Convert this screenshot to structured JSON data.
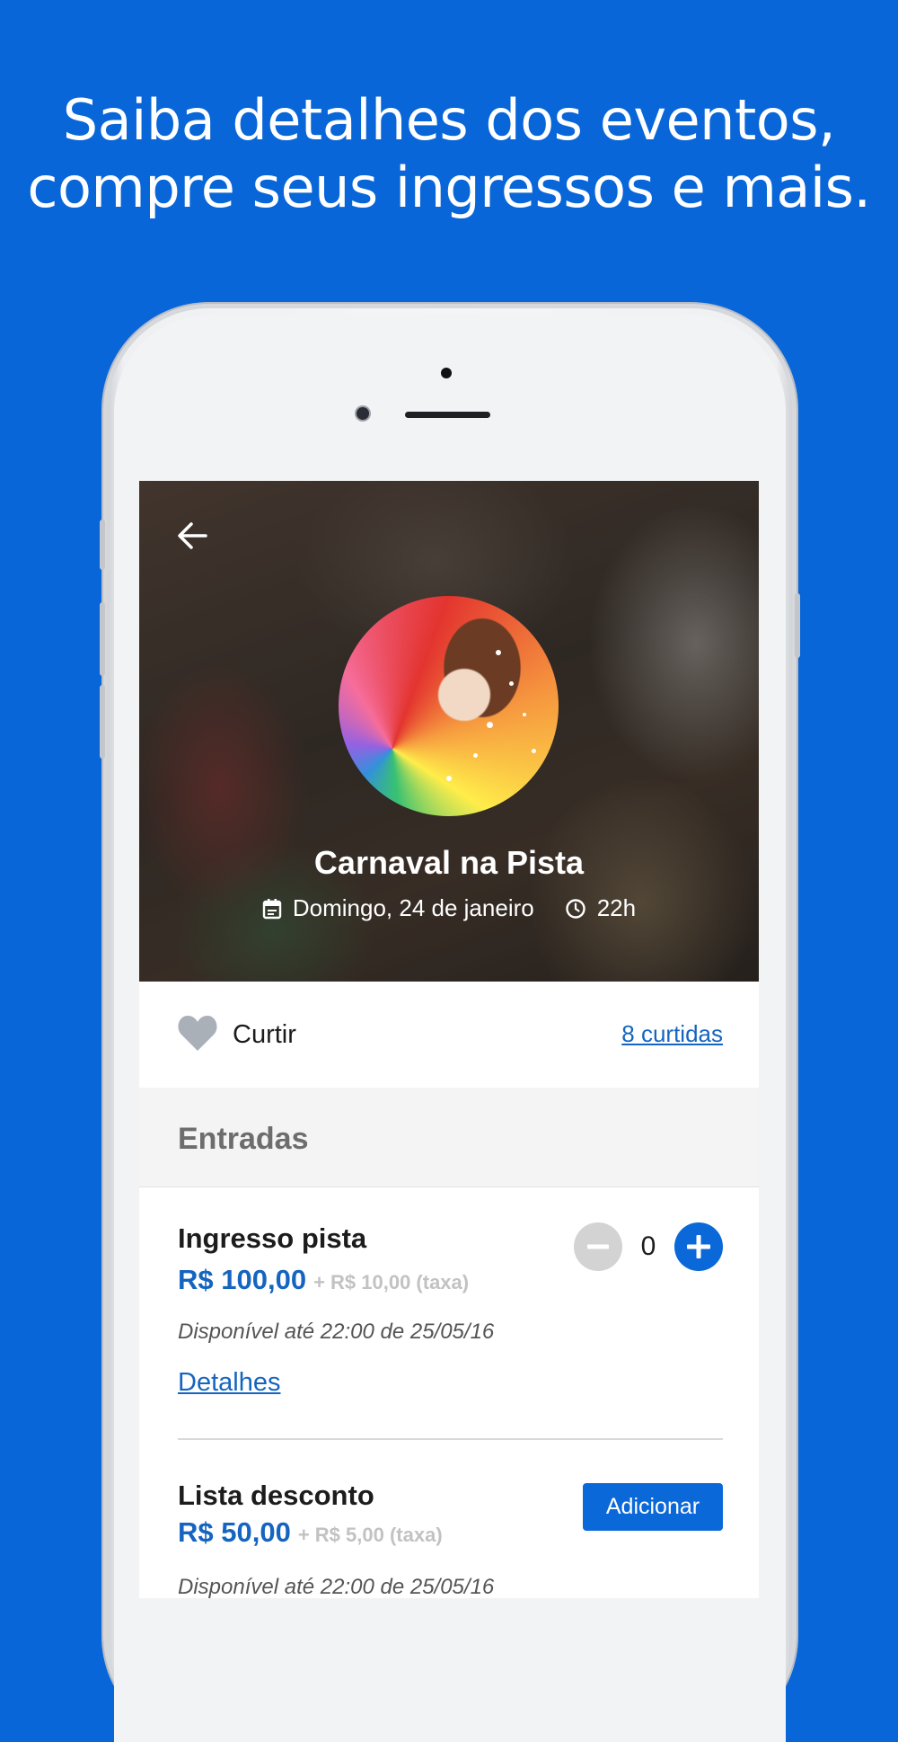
{
  "headline": {
    "line1": "Saiba detalhes dos eventos,",
    "line2": "compre seus ingressos e mais."
  },
  "event": {
    "title": "Carnaval na Pista",
    "date": "Domingo, 24 de janeiro",
    "time": "22h"
  },
  "likes": {
    "label": "Curtir",
    "count_link": "8 curtidas"
  },
  "section": {
    "title": "Entradas"
  },
  "tickets": [
    {
      "name": "Ingresso pista",
      "price": "R$ 100,00",
      "fee": "+ R$ 10,00 (taxa)",
      "available": "Disponível até 22:00 de 25/05/16",
      "details_link": "Detalhes",
      "quantity": "0"
    },
    {
      "name": "Lista desconto",
      "price": "R$ 50,00",
      "fee": "+ R$ 5,00 (taxa)",
      "available": "Disponível até 22:00 de 25/05/16",
      "add_label": "Adicionar"
    }
  ],
  "colors": {
    "background": "#0866d9",
    "accent": "#1565c0",
    "button": "#0b68d9",
    "heart": "#a9b0b8"
  }
}
